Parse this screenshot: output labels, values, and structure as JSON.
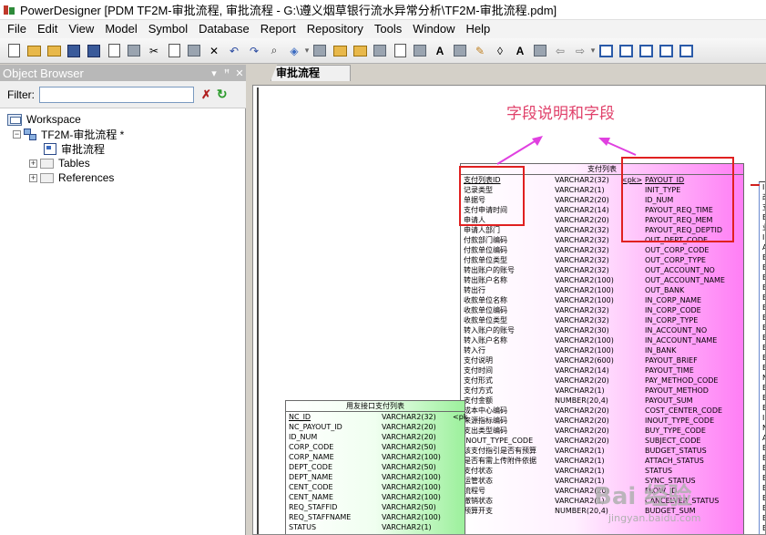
{
  "window": {
    "title": "PowerDesigner [PDM TF2M-审批流程, 审批流程 - G:\\遵义烟草银行流水异常分析\\TF2M-审批流程.pdm]"
  },
  "menubar": {
    "items": [
      {
        "label": "File"
      },
      {
        "label": "Edit"
      },
      {
        "label": "View"
      },
      {
        "label": "Model"
      },
      {
        "label": "Symbol"
      },
      {
        "label": "Database"
      },
      {
        "label": "Report"
      },
      {
        "label": "Repository"
      },
      {
        "label": "Tools"
      },
      {
        "label": "Window"
      },
      {
        "label": "Help"
      }
    ]
  },
  "object_browser": {
    "title": "Object Browser",
    "filter_label": "Filter:",
    "filter_value": "",
    "tree": {
      "workspace": "Workspace",
      "model": "TF2M-审批流程 *",
      "diagram": "审批流程",
      "tables": "Tables",
      "references": "References"
    }
  },
  "document": {
    "tab_label": "审批流程",
    "annotation": "字段说明和字段",
    "watermark": "Bai 经验",
    "watermark_sub": "jingyan.baidu.com"
  },
  "main_entity": {
    "title": "支付列表",
    "rows": [
      {
        "comment": "支付列表ID",
        "type": "VARCHAR2(32)",
        "key": "<pk>",
        "field": "PAYOUT_ID"
      },
      {
        "comment": "记录类型",
        "type": "VARCHAR2(1)",
        "key": "",
        "field": "INIT_TYPE"
      },
      {
        "comment": "单据号",
        "type": "VARCHAR2(20)",
        "key": "",
        "field": "ID_NUM"
      },
      {
        "comment": "支付申请时间",
        "type": "VARCHAR2(14)",
        "key": "",
        "field": "PAYOUT_REQ_TIME"
      },
      {
        "comment": "申请人",
        "type": "VARCHAR2(20)",
        "key": "",
        "field": "PAYOUT_REQ_MEM"
      },
      {
        "comment": "申请人部门",
        "type": "VARCHAR2(32)",
        "key": "",
        "field": "PAYOUT_REQ_DEPTID"
      },
      {
        "comment": "付款部门编码",
        "type": "VARCHAR2(32)",
        "key": "",
        "field": "OUT_DEPT_CODE"
      },
      {
        "comment": "付款单位编码",
        "type": "VARCHAR2(32)",
        "key": "",
        "field": "OUT_CORP_CODE"
      },
      {
        "comment": "付款单位类型",
        "type": "VARCHAR2(32)",
        "key": "",
        "field": "OUT_CORP_TYPE"
      },
      {
        "comment": "转出账户的账号",
        "type": "VARCHAR2(32)",
        "key": "",
        "field": "OUT_ACCOUNT_NO"
      },
      {
        "comment": "转出账户名称",
        "type": "VARCHAR2(100)",
        "key": "",
        "field": "OUT_ACCOUNT_NAME"
      },
      {
        "comment": "转出行",
        "type": "VARCHAR2(100)",
        "key": "",
        "field": "OUT_BANK"
      },
      {
        "comment": "收款单位名称",
        "type": "VARCHAR2(100)",
        "key": "",
        "field": "IN_CORP_NAME"
      },
      {
        "comment": "收款单位编码",
        "type": "VARCHAR2(32)",
        "key": "",
        "field": "IN_CORP_CODE"
      },
      {
        "comment": "收款单位类型",
        "type": "VARCHAR2(32)",
        "key": "",
        "field": "IN_CORP_TYPE"
      },
      {
        "comment": "转入账户的账号",
        "type": "VARCHAR2(30)",
        "key": "",
        "field": "IN_ACCOUNT_NO"
      },
      {
        "comment": "转入账户名称",
        "type": "VARCHAR2(100)",
        "key": "",
        "field": "IN_ACCOUNT_NAME"
      },
      {
        "comment": "转入行",
        "type": "VARCHAR2(100)",
        "key": "",
        "field": "IN_BANK"
      },
      {
        "comment": "支付说明",
        "type": "VARCHAR2(600)",
        "key": "",
        "field": "PAYOUT_BRIEF"
      },
      {
        "comment": "支付时间",
        "type": "VARCHAR2(14)",
        "key": "",
        "field": "PAYOUT_TIME"
      },
      {
        "comment": "支付形式",
        "type": "VARCHAR2(20)",
        "key": "",
        "field": "PAY_METHOD_CODE"
      },
      {
        "comment": "支付方式",
        "type": "VARCHAR2(1)",
        "key": "",
        "field": "PAYOUT_METHOD"
      },
      {
        "comment": "支付金额",
        "type": "NUMBER(20,4)",
        "key": "",
        "field": "PAYOUT_SUM"
      },
      {
        "comment": "成本中心编码",
        "type": "VARCHAR2(20)",
        "key": "",
        "field": "COST_CENTER_CODE"
      },
      {
        "comment": "来源指标编码",
        "type": "VARCHAR2(20)",
        "key": "",
        "field": "INOUT_TYPE_CODE"
      },
      {
        "comment": "支出类型编码",
        "type": "VARCHAR2(20)",
        "key": "",
        "field": "BUY_TYPE_CODE"
      },
      {
        "comment": "INOUT_TYPE_CODE",
        "type": "VARCHAR2(20)",
        "key": "",
        "field": "SUBJECT_CODE"
      },
      {
        "comment": "该支付指引是否有预算",
        "type": "VARCHAR2(1)",
        "key": "",
        "field": "BUDGET_STATUS"
      },
      {
        "comment": "是否有需上传附件依据",
        "type": "VARCHAR2(1)",
        "key": "",
        "field": "ATTACH_STATUS"
      },
      {
        "comment": "支付状态",
        "type": "VARCHAR2(1)",
        "key": "",
        "field": "STATUS"
      },
      {
        "comment": "运管状态",
        "type": "VARCHAR2(1)",
        "key": "",
        "field": "SYNC_STATUS"
      },
      {
        "comment": "流程号",
        "type": "VARCHAR2(20)",
        "key": "",
        "field": "FLOW_ID"
      },
      {
        "comment": "撤销状态",
        "type": "VARCHAR2(1)",
        "key": "",
        "field": "CANCELVER_STATUS"
      },
      {
        "comment": "预算开支",
        "type": "NUMBER(20,4)",
        "key": "",
        "field": "BUDGET_SUM"
      }
    ]
  },
  "green_entity": {
    "title": "用友接口支付列表",
    "rows": [
      {
        "field": "NC_ID",
        "type": "VARCHAR2(32)",
        "key": "<pk"
      },
      {
        "field": "NC_PAYOUT_ID",
        "type": "VARCHAR2(20)",
        "key": ""
      },
      {
        "field": "ID_NUM",
        "type": "VARCHAR2(20)",
        "key": ""
      },
      {
        "field": "CORP_CODE",
        "type": "VARCHAR2(50)",
        "key": ""
      },
      {
        "field": "CORP_NAME",
        "type": "VARCHAR2(100)",
        "key": ""
      },
      {
        "field": "DEPT_CODE",
        "type": "VARCHAR2(50)",
        "key": ""
      },
      {
        "field": "DEPT_NAME",
        "type": "VARCHAR2(100)",
        "key": ""
      },
      {
        "field": "CENT_CODE",
        "type": "VARCHAR2(100)",
        "key": ""
      },
      {
        "field": "CENT_NAME",
        "type": "VARCHAR2(100)",
        "key": ""
      },
      {
        "field": "REQ_STAFFID",
        "type": "VARCHAR2(50)",
        "key": ""
      },
      {
        "field": "REQ_STAFFNAME",
        "type": "VARCHAR2(100)",
        "key": ""
      },
      {
        "field": "STATUS",
        "type": "VARCHAR2(1)",
        "key": ""
      }
    ]
  },
  "right_entity": {
    "fragments": [
      "I",
      "改",
      "支",
      "B",
      "业",
      "I",
      "A",
      "B",
      "B",
      "B",
      "B",
      "B",
      "B",
      "B",
      "B",
      "B",
      "B",
      "B",
      "B",
      "N",
      "B",
      "B",
      "B",
      "I",
      "N",
      "A",
      "B",
      "B",
      "B",
      "B",
      "B",
      "B",
      "B",
      "B",
      "B",
      "B"
    ]
  },
  "colors": {
    "annotation": "#e0406a",
    "highlight": "#e02020",
    "arrow": "#e040e0",
    "main_entity_gradient_end": "#ff7ef5",
    "green_entity_gradient_end": "#9cf09c"
  }
}
